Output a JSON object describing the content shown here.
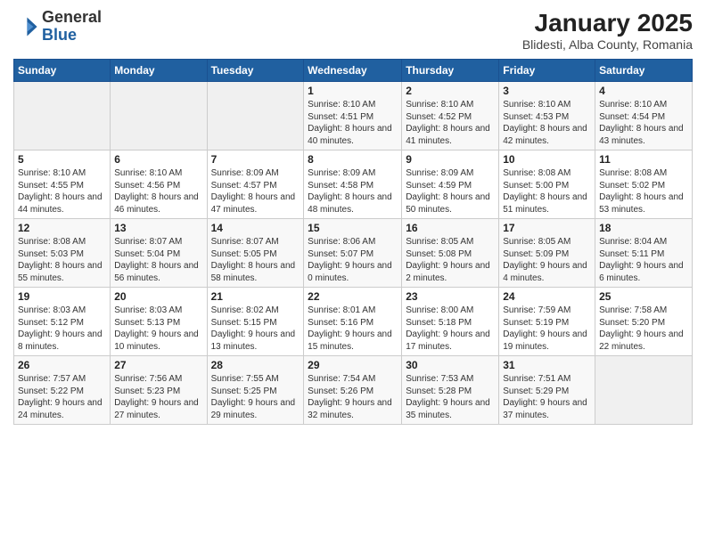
{
  "header": {
    "logo_line1": "General",
    "logo_line2": "Blue",
    "title": "January 2025",
    "subtitle": "Blidesti, Alba County, Romania"
  },
  "days_of_week": [
    "Sunday",
    "Monday",
    "Tuesday",
    "Wednesday",
    "Thursday",
    "Friday",
    "Saturday"
  ],
  "weeks": [
    [
      {
        "day": "",
        "info": ""
      },
      {
        "day": "",
        "info": ""
      },
      {
        "day": "",
        "info": ""
      },
      {
        "day": "1",
        "info": "Sunrise: 8:10 AM\nSunset: 4:51 PM\nDaylight: 8 hours and 40 minutes."
      },
      {
        "day": "2",
        "info": "Sunrise: 8:10 AM\nSunset: 4:52 PM\nDaylight: 8 hours and 41 minutes."
      },
      {
        "day": "3",
        "info": "Sunrise: 8:10 AM\nSunset: 4:53 PM\nDaylight: 8 hours and 42 minutes."
      },
      {
        "day": "4",
        "info": "Sunrise: 8:10 AM\nSunset: 4:54 PM\nDaylight: 8 hours and 43 minutes."
      }
    ],
    [
      {
        "day": "5",
        "info": "Sunrise: 8:10 AM\nSunset: 4:55 PM\nDaylight: 8 hours and 44 minutes."
      },
      {
        "day": "6",
        "info": "Sunrise: 8:10 AM\nSunset: 4:56 PM\nDaylight: 8 hours and 46 minutes."
      },
      {
        "day": "7",
        "info": "Sunrise: 8:09 AM\nSunset: 4:57 PM\nDaylight: 8 hours and 47 minutes."
      },
      {
        "day": "8",
        "info": "Sunrise: 8:09 AM\nSunset: 4:58 PM\nDaylight: 8 hours and 48 minutes."
      },
      {
        "day": "9",
        "info": "Sunrise: 8:09 AM\nSunset: 4:59 PM\nDaylight: 8 hours and 50 minutes."
      },
      {
        "day": "10",
        "info": "Sunrise: 8:08 AM\nSunset: 5:00 PM\nDaylight: 8 hours and 51 minutes."
      },
      {
        "day": "11",
        "info": "Sunrise: 8:08 AM\nSunset: 5:02 PM\nDaylight: 8 hours and 53 minutes."
      }
    ],
    [
      {
        "day": "12",
        "info": "Sunrise: 8:08 AM\nSunset: 5:03 PM\nDaylight: 8 hours and 55 minutes."
      },
      {
        "day": "13",
        "info": "Sunrise: 8:07 AM\nSunset: 5:04 PM\nDaylight: 8 hours and 56 minutes."
      },
      {
        "day": "14",
        "info": "Sunrise: 8:07 AM\nSunset: 5:05 PM\nDaylight: 8 hours and 58 minutes."
      },
      {
        "day": "15",
        "info": "Sunrise: 8:06 AM\nSunset: 5:07 PM\nDaylight: 9 hours and 0 minutes."
      },
      {
        "day": "16",
        "info": "Sunrise: 8:05 AM\nSunset: 5:08 PM\nDaylight: 9 hours and 2 minutes."
      },
      {
        "day": "17",
        "info": "Sunrise: 8:05 AM\nSunset: 5:09 PM\nDaylight: 9 hours and 4 minutes."
      },
      {
        "day": "18",
        "info": "Sunrise: 8:04 AM\nSunset: 5:11 PM\nDaylight: 9 hours and 6 minutes."
      }
    ],
    [
      {
        "day": "19",
        "info": "Sunrise: 8:03 AM\nSunset: 5:12 PM\nDaylight: 9 hours and 8 minutes."
      },
      {
        "day": "20",
        "info": "Sunrise: 8:03 AM\nSunset: 5:13 PM\nDaylight: 9 hours and 10 minutes."
      },
      {
        "day": "21",
        "info": "Sunrise: 8:02 AM\nSunset: 5:15 PM\nDaylight: 9 hours and 13 minutes."
      },
      {
        "day": "22",
        "info": "Sunrise: 8:01 AM\nSunset: 5:16 PM\nDaylight: 9 hours and 15 minutes."
      },
      {
        "day": "23",
        "info": "Sunrise: 8:00 AM\nSunset: 5:18 PM\nDaylight: 9 hours and 17 minutes."
      },
      {
        "day": "24",
        "info": "Sunrise: 7:59 AM\nSunset: 5:19 PM\nDaylight: 9 hours and 19 minutes."
      },
      {
        "day": "25",
        "info": "Sunrise: 7:58 AM\nSunset: 5:20 PM\nDaylight: 9 hours and 22 minutes."
      }
    ],
    [
      {
        "day": "26",
        "info": "Sunrise: 7:57 AM\nSunset: 5:22 PM\nDaylight: 9 hours and 24 minutes."
      },
      {
        "day": "27",
        "info": "Sunrise: 7:56 AM\nSunset: 5:23 PM\nDaylight: 9 hours and 27 minutes."
      },
      {
        "day": "28",
        "info": "Sunrise: 7:55 AM\nSunset: 5:25 PM\nDaylight: 9 hours and 29 minutes."
      },
      {
        "day": "29",
        "info": "Sunrise: 7:54 AM\nSunset: 5:26 PM\nDaylight: 9 hours and 32 minutes."
      },
      {
        "day": "30",
        "info": "Sunrise: 7:53 AM\nSunset: 5:28 PM\nDaylight: 9 hours and 35 minutes."
      },
      {
        "day": "31",
        "info": "Sunrise: 7:51 AM\nSunset: 5:29 PM\nDaylight: 9 hours and 37 minutes."
      },
      {
        "day": "",
        "info": ""
      }
    ]
  ]
}
